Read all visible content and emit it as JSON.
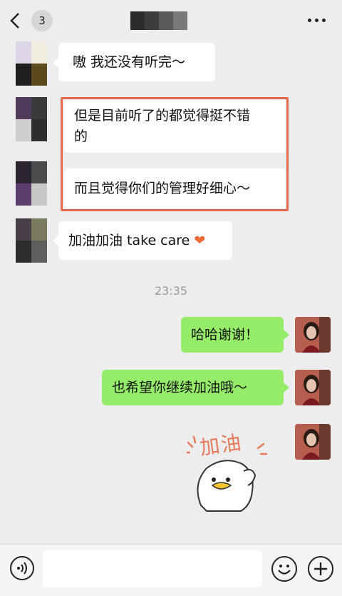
{
  "header": {
    "unread_count": "3",
    "contact_name_obscured": true
  },
  "messages": [
    {
      "from": "other",
      "text": "嗷 我还没有听完～"
    },
    {
      "from": "other",
      "text": "但是目前听了的都觉得挺不错的",
      "line1": "但是目前听了的都觉得挺不错",
      "line2": "的"
    },
    {
      "from": "other",
      "text": "而且觉得你们的管理好细心～"
    },
    {
      "from": "other",
      "text": "加油加油 take care",
      "emoji": "❤"
    },
    {
      "timestamp": "23:35"
    },
    {
      "from": "me",
      "text": "哈哈谢谢！"
    },
    {
      "from": "me",
      "text": "也希望你继续加油哦～"
    },
    {
      "from": "me",
      "sticker": "duck-cheer-sticker",
      "sticker_text": "加油"
    }
  ],
  "input": {
    "placeholder": ""
  },
  "colors": {
    "background": "#ededed",
    "bubble_in": "#ffffff",
    "bubble_out": "#95ec69",
    "highlight_border": "#e4684e",
    "heart": "#f06a35"
  },
  "icons": [
    "back-chevron-icon",
    "more-icon",
    "voice-icon",
    "emoji-icon",
    "plus-icon"
  ]
}
